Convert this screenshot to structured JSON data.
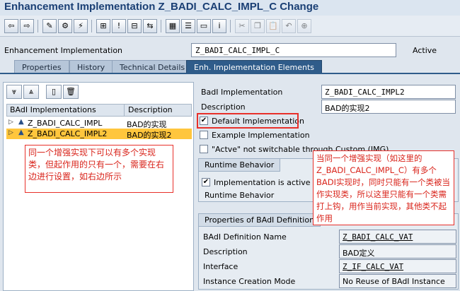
{
  "window": {
    "title": "Enhancement Implementation Z_BADI_CALC_IMPL_C Change"
  },
  "toolbar": {
    "buttons": [
      {
        "icon": "back-icon",
        "glyph": "⇦"
      },
      {
        "icon": "forward-icon",
        "glyph": "⇨"
      },
      {
        "icon": "display-change-icon",
        "glyph": "✎"
      },
      {
        "icon": "other-object-icon",
        "glyph": "⚙"
      },
      {
        "icon": "activate-icon",
        "glyph": "⚡"
      },
      {
        "icon": "hierarchy-icon",
        "glyph": "⊞"
      },
      {
        "icon": "info-icon",
        "glyph": "!"
      },
      {
        "icon": "where-used-icon",
        "glyph": "⊟"
      },
      {
        "icon": "navigate-icon",
        "glyph": "⇆"
      },
      {
        "icon": "layout-icon",
        "glyph": "▦"
      },
      {
        "icon": "list-icon",
        "glyph": "☰"
      },
      {
        "icon": "display-icon",
        "glyph": "▭"
      },
      {
        "icon": "information-icon",
        "glyph": "i"
      },
      {
        "icon": "cut-icon",
        "glyph": "✂"
      },
      {
        "icon": "copy-icon",
        "glyph": "❐"
      },
      {
        "icon": "paste-icon",
        "glyph": "📋"
      },
      {
        "icon": "undo-icon",
        "glyph": "↶"
      },
      {
        "icon": "insert-icon",
        "glyph": "⊕"
      }
    ]
  },
  "header": {
    "label": "Enhancement Implementation",
    "value": "Z_BADI_CALC_IMPL_C",
    "status": "Active"
  },
  "tabs": [
    {
      "label": "Properties",
      "active": false
    },
    {
      "label": "History",
      "active": false
    },
    {
      "label": "Technical Details",
      "active": false
    },
    {
      "label": "Enh. Implementation Elements",
      "active": true
    }
  ],
  "tree": {
    "toolbar": [
      {
        "icon": "expand-all-icon",
        "glyph": "⩔"
      },
      {
        "icon": "collapse-all-icon",
        "glyph": "⩓"
      },
      {
        "icon": "create-icon",
        "glyph": "▯"
      },
      {
        "icon": "delete-icon",
        "glyph": "🗑"
      }
    ],
    "col1": "BAdI Implementations",
    "col2": "Description",
    "rows": [
      {
        "name": "Z_BADI_CALC_IMPL",
        "desc": "BAD的实现",
        "selected": false
      },
      {
        "name": "Z_BADI_CALC_IMPL2",
        "desc": "BAD的实现2",
        "selected": true
      }
    ]
  },
  "notes": {
    "left": "同一个增强实现下可以有多个实现类，但起作用的只有一个，需要在右边进行设置，如右边所示",
    "right": "当同一个增强实现（如这里的Z_BADI_CALC_IMPL_C）有多个BADI实现时，同时只能有一个类被当作实现类，所以这里只能有一个类需打上钩，用作当前实现，其他类不起作用"
  },
  "details": {
    "badi_impl_label": "BadI Implementation",
    "badi_impl_value": "Z_BADI_CALC_IMPL2",
    "description_label": "Description",
    "description_value": "BAD的实现2",
    "default_impl_label": "Default Implementation",
    "default_impl_checked": "✔",
    "example_impl_label": "Example Implementation",
    "example_impl_checked": "",
    "active_switch_label": "\"Actve\" not switchable through Custom (IMG)",
    "active_switch_checked": ""
  },
  "runtime": {
    "title": "Runtime Behavior",
    "active_label": "Implementation is active",
    "active_checked": "✔",
    "behavior_label": "Runtime Behavior"
  },
  "definition": {
    "title": "Properties of BAdI Definition",
    "name_label": "BAdI Definition Name",
    "name_value": "Z_BADI_CALC_VAT",
    "desc_label": "Description",
    "desc_value": "BAD定义",
    "interface_label": "Interface",
    "interface_value": "Z_IF_CALC_VAT",
    "mode_label": "Instance Creation Mode",
    "mode_value": "No Reuse of BAdI Instance"
  }
}
